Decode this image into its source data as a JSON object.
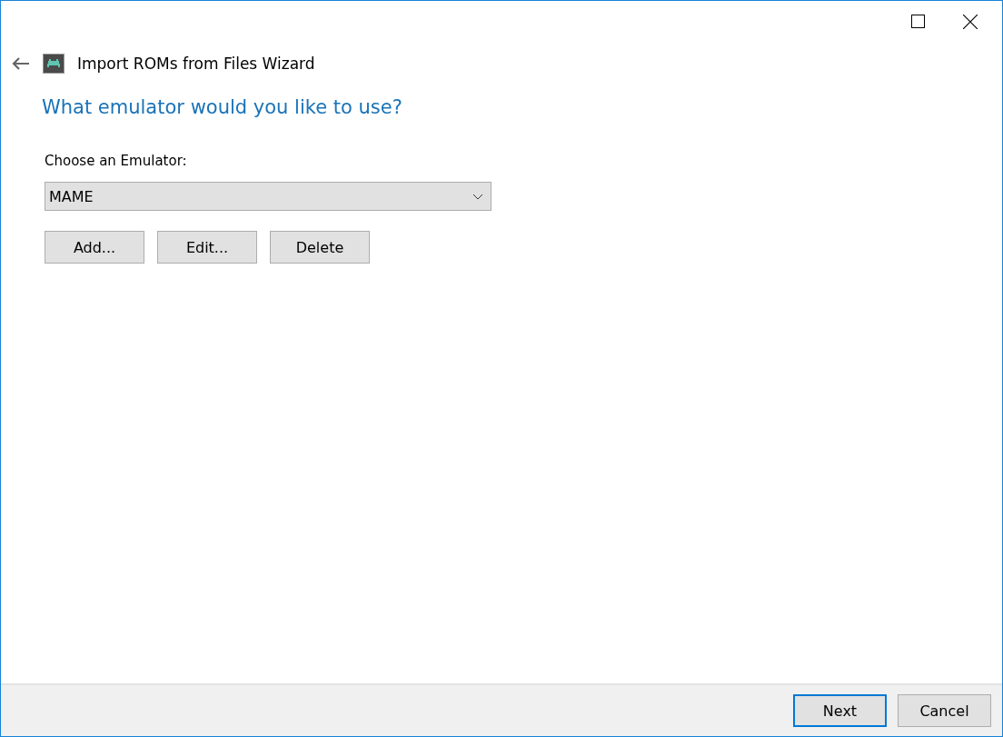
{
  "window": {
    "title": "Import ROMs from Files Wizard"
  },
  "page": {
    "heading": "What emulator would you like to use?",
    "label": "Choose an Emulator:",
    "emulator": {
      "value": "MAME"
    },
    "actions": [
      "Add...",
      "Edit...",
      "Delete"
    ]
  },
  "footer_buttons": [
    {
      "label": "Next",
      "focused": true
    },
    {
      "label": "Cancel",
      "focused": false
    }
  ]
}
